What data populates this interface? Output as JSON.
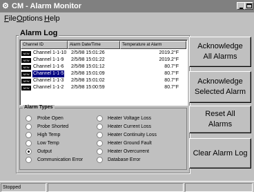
{
  "window": {
    "title": "CM - Alarm Monitor",
    "icon": "app-icon"
  },
  "menu": [
    {
      "label": "File",
      "underline": "F"
    },
    {
      "label": "Options",
      "underline": "O"
    },
    {
      "label": "Help",
      "underline": "H"
    }
  ],
  "alarm_log": {
    "label": "Alarm Log",
    "columns": [
      "Channel ID",
      "Alarm Date/Time",
      "Temperature at Alarm"
    ],
    "rows": [
      {
        "badge": "NEW",
        "channel": "Channel 1-1-10",
        "datetime": "2/5/98 15:01:26",
        "temp": "2019.2°F",
        "selected": false
      },
      {
        "badge": "NEW",
        "channel": "Channel 1-1-9",
        "datetime": "2/5/98 15:01:22",
        "temp": "2019.2°F",
        "selected": false
      },
      {
        "badge": "NEW",
        "channel": "Channel 1-1-6",
        "datetime": "2/5/98 15:01:12",
        "temp": "80.7°F",
        "selected": false
      },
      {
        "badge": "NEW",
        "channel": "Channel 1-1-5",
        "datetime": "2/5/98 15:01:09",
        "temp": "80.7°F",
        "selected": true
      },
      {
        "badge": "NEW",
        "channel": "Channel 1-1-3",
        "datetime": "2/5/98 15:01:02",
        "temp": "80.7°F",
        "selected": false
      },
      {
        "badge": "NEW",
        "channel": "Channel 1-1-2",
        "datetime": "2/5/98 15:00:59",
        "temp": "80.7°F",
        "selected": false
      }
    ]
  },
  "alarm_types": {
    "label": "Alarm Types",
    "left": [
      {
        "label": "Probe Open",
        "checked": false
      },
      {
        "label": "Probe Shorted",
        "checked": false
      },
      {
        "label": "High Temp",
        "checked": false
      },
      {
        "label": "Low Temp",
        "checked": false
      },
      {
        "label": "Output",
        "checked": true
      },
      {
        "label": "Communication Error",
        "checked": false
      }
    ],
    "right": [
      {
        "label": "Heater Voltage Loss",
        "checked": false
      },
      {
        "label": "Heater Current Loss",
        "checked": false
      },
      {
        "label": "Heater Continuity Loss",
        "checked": false
      },
      {
        "label": "Heater Ground Fault",
        "checked": false
      },
      {
        "label": "Heater Overcurrent",
        "checked": false
      },
      {
        "label": "Database Error",
        "checked": false
      }
    ]
  },
  "buttons": {
    "ack_all": "Acknowledge All Alarms",
    "ack_selected": "Acknowledge Selected Alarm",
    "reset_all": "Reset All Alarms",
    "clear_log": "Clear Alarm Log"
  },
  "status": {
    "text": "Stopped"
  }
}
